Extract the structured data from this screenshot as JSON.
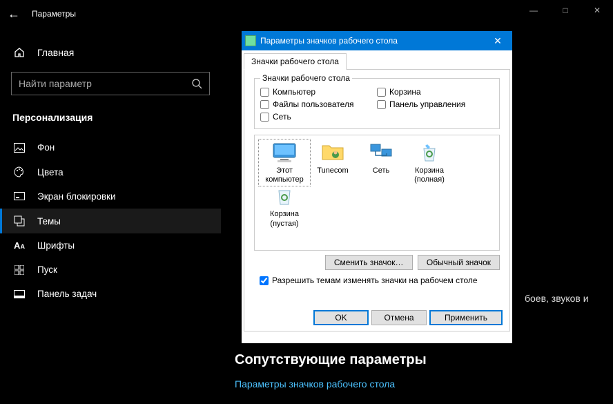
{
  "window": {
    "title": "Параметры",
    "minimize": "—",
    "maximize": "□",
    "close": "✕",
    "back": "←"
  },
  "sidebar": {
    "home": "Главная",
    "search_placeholder": "Найти параметр",
    "section": "Персонализация",
    "items": [
      {
        "label": "Фон"
      },
      {
        "label": "Цвета"
      },
      {
        "label": "Экран блокировки"
      },
      {
        "label": "Темы"
      },
      {
        "label": "Шрифты"
      },
      {
        "label": "Пуск"
      },
      {
        "label": "Панель задач"
      }
    ]
  },
  "main": {
    "partial_text": "боев, звуков и",
    "related_heading": "Сопутствующие параметры",
    "related_link": "Параметры значков рабочего стола"
  },
  "dialog": {
    "title": "Параметры значков рабочего стола",
    "close": "✕",
    "tab": "Значки рабочего стола",
    "group_legend": "Значки рабочего стола",
    "checkboxes": {
      "computer": "Компьютер",
      "recycle": "Корзина",
      "userfiles": "Файлы пользователя",
      "controlpanel": "Панель управления",
      "network": "Сеть"
    },
    "icons": [
      {
        "label1": "Этот",
        "label2": "компьютер"
      },
      {
        "label1": "Tunecom",
        "label2": ""
      },
      {
        "label1": "Сеть",
        "label2": ""
      },
      {
        "label1": "Корзина",
        "label2": "(полная)"
      },
      {
        "label1": "Корзина",
        "label2": "(пустая)"
      }
    ],
    "change_icon_btn": "Сменить значок…",
    "default_icon_btn": "Обычный значок",
    "allow_themes": "Разрешить темам изменять значки на рабочем столе",
    "ok": "OK",
    "cancel": "Отмена",
    "apply": "Применить"
  }
}
